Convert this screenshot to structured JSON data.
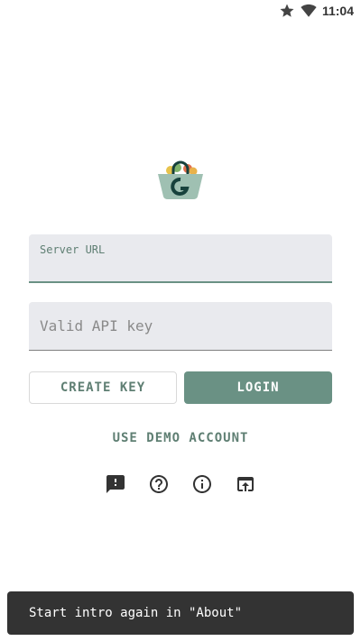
{
  "status_bar": {
    "time": "11:04",
    "icons": [
      "star-icon",
      "wifi-icon"
    ]
  },
  "logo": {
    "letter": "G"
  },
  "form": {
    "server_url": {
      "label": "Server URL",
      "value": ""
    },
    "api_key": {
      "placeholder": "Valid API key",
      "value": ""
    }
  },
  "buttons": {
    "create_key": "CREATE KEY",
    "login": "LOGIN",
    "demo": "USE DEMO ACCOUNT"
  },
  "icon_row": [
    "feedback-icon",
    "help-icon",
    "info-icon",
    "open-in-new-icon"
  ],
  "snackbar": {
    "text": "Start intro again in \"About\""
  },
  "colors": {
    "accent": "#6a9184",
    "accent_text": "#5f7f73",
    "field_bg": "#e9eaee",
    "snackbar_bg": "#333333"
  }
}
